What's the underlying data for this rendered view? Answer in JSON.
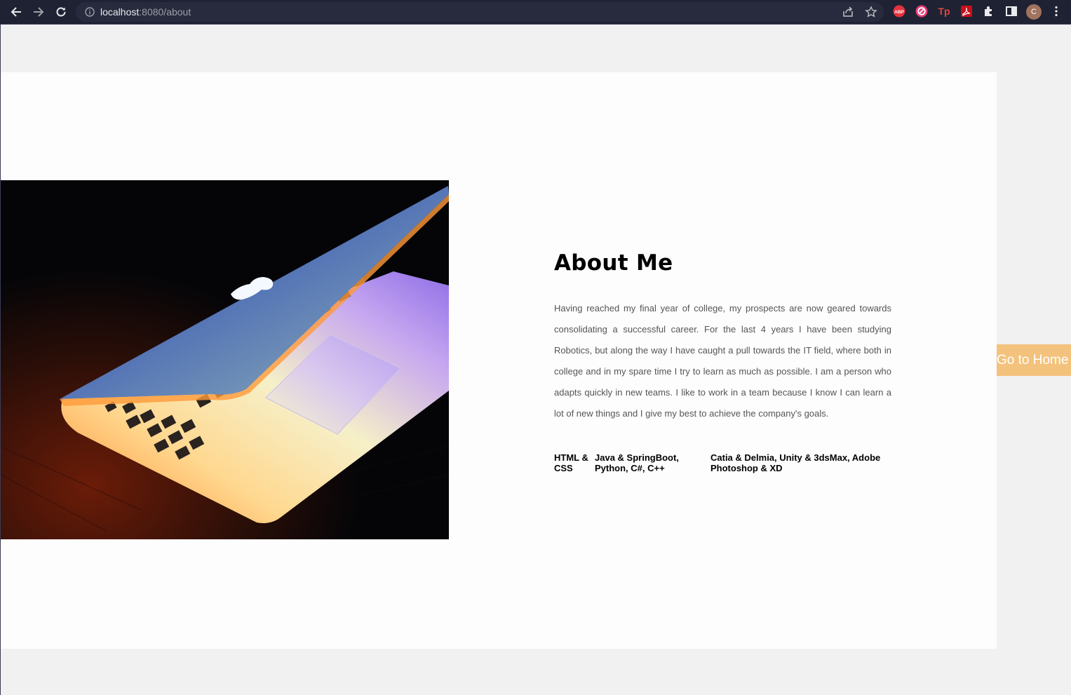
{
  "browser": {
    "url_host": "localhost",
    "url_path": ":8080/about",
    "profile_initial": "C",
    "extensions": [
      {
        "name": "abp-icon",
        "label": "ABP",
        "color": "#e6323e"
      },
      {
        "name": "block-icon",
        "label": "",
        "color": "#e63c78"
      },
      {
        "name": "tp-icon",
        "label": "Tp",
        "color": "#e0463c"
      },
      {
        "name": "acrobat-icon",
        "label": "",
        "color": "#c8101a"
      }
    ]
  },
  "about": {
    "title": "About Me",
    "paragraph": "Having reached my final year of college, my prospects are now geared towards consolidating a successful career. For the last 4 years I have been studying Robotics, but along the way I have caught a pull towards the IT field, where both in college and in my spare time I try to learn as much as possible. I am a person who adapts quickly in new teams. I like to work in a team because I know I can learn a lot of new things and I give my best to achieve the company's goals.",
    "skills": [
      "HTML & CSS",
      "Java & SpringBoot, Python, C#, C++",
      "Catia & Delmia, Unity & 3dsMax, Adobe Photoshop & XD"
    ]
  },
  "home_button": {
    "label": "Go to Home",
    "color": "#f3c27c"
  },
  "colors": {
    "page_bg": "#f1f1f1",
    "card_bg": "#fdfdfd",
    "browser_chrome": "#1f2233"
  }
}
